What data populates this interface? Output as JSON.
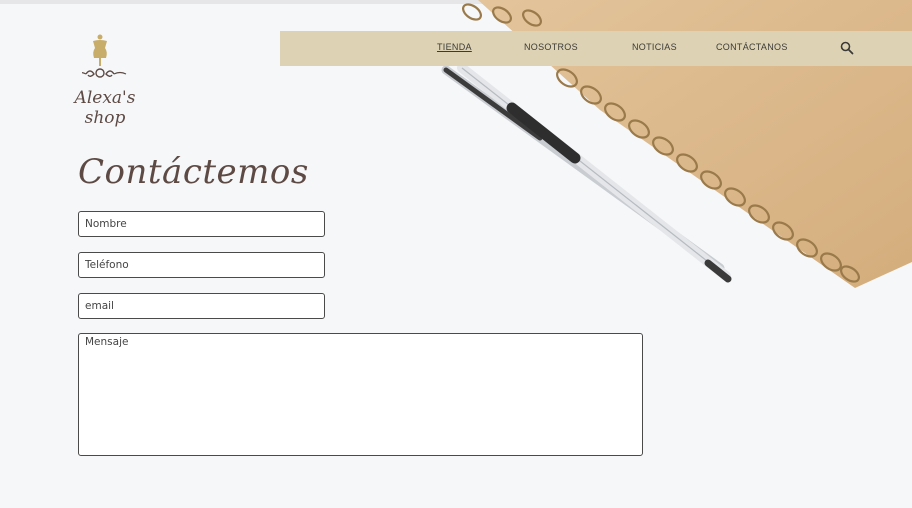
{
  "brand": {
    "name": "Alexa's shop"
  },
  "nav": {
    "items": [
      {
        "label": "TIENDA",
        "active": true
      },
      {
        "label": "NOSOTROS",
        "active": false
      },
      {
        "label": "NOTICIAS",
        "active": false
      },
      {
        "label": "CONTÁCTANOS",
        "active": false
      }
    ],
    "search_icon": "search-icon"
  },
  "contact": {
    "title": "Contáctemos",
    "name_placeholder": "Nombre",
    "phone_placeholder": "Teléfono",
    "email_placeholder": "email",
    "message_placeholder": "Mensaje"
  },
  "colors": {
    "navbar_bg": "#ddd3b4",
    "brand_text": "#5e4a44",
    "mannequin": "#c8ad6a",
    "notebook": "#dcb98c",
    "spiral": "#9a7a4a"
  }
}
